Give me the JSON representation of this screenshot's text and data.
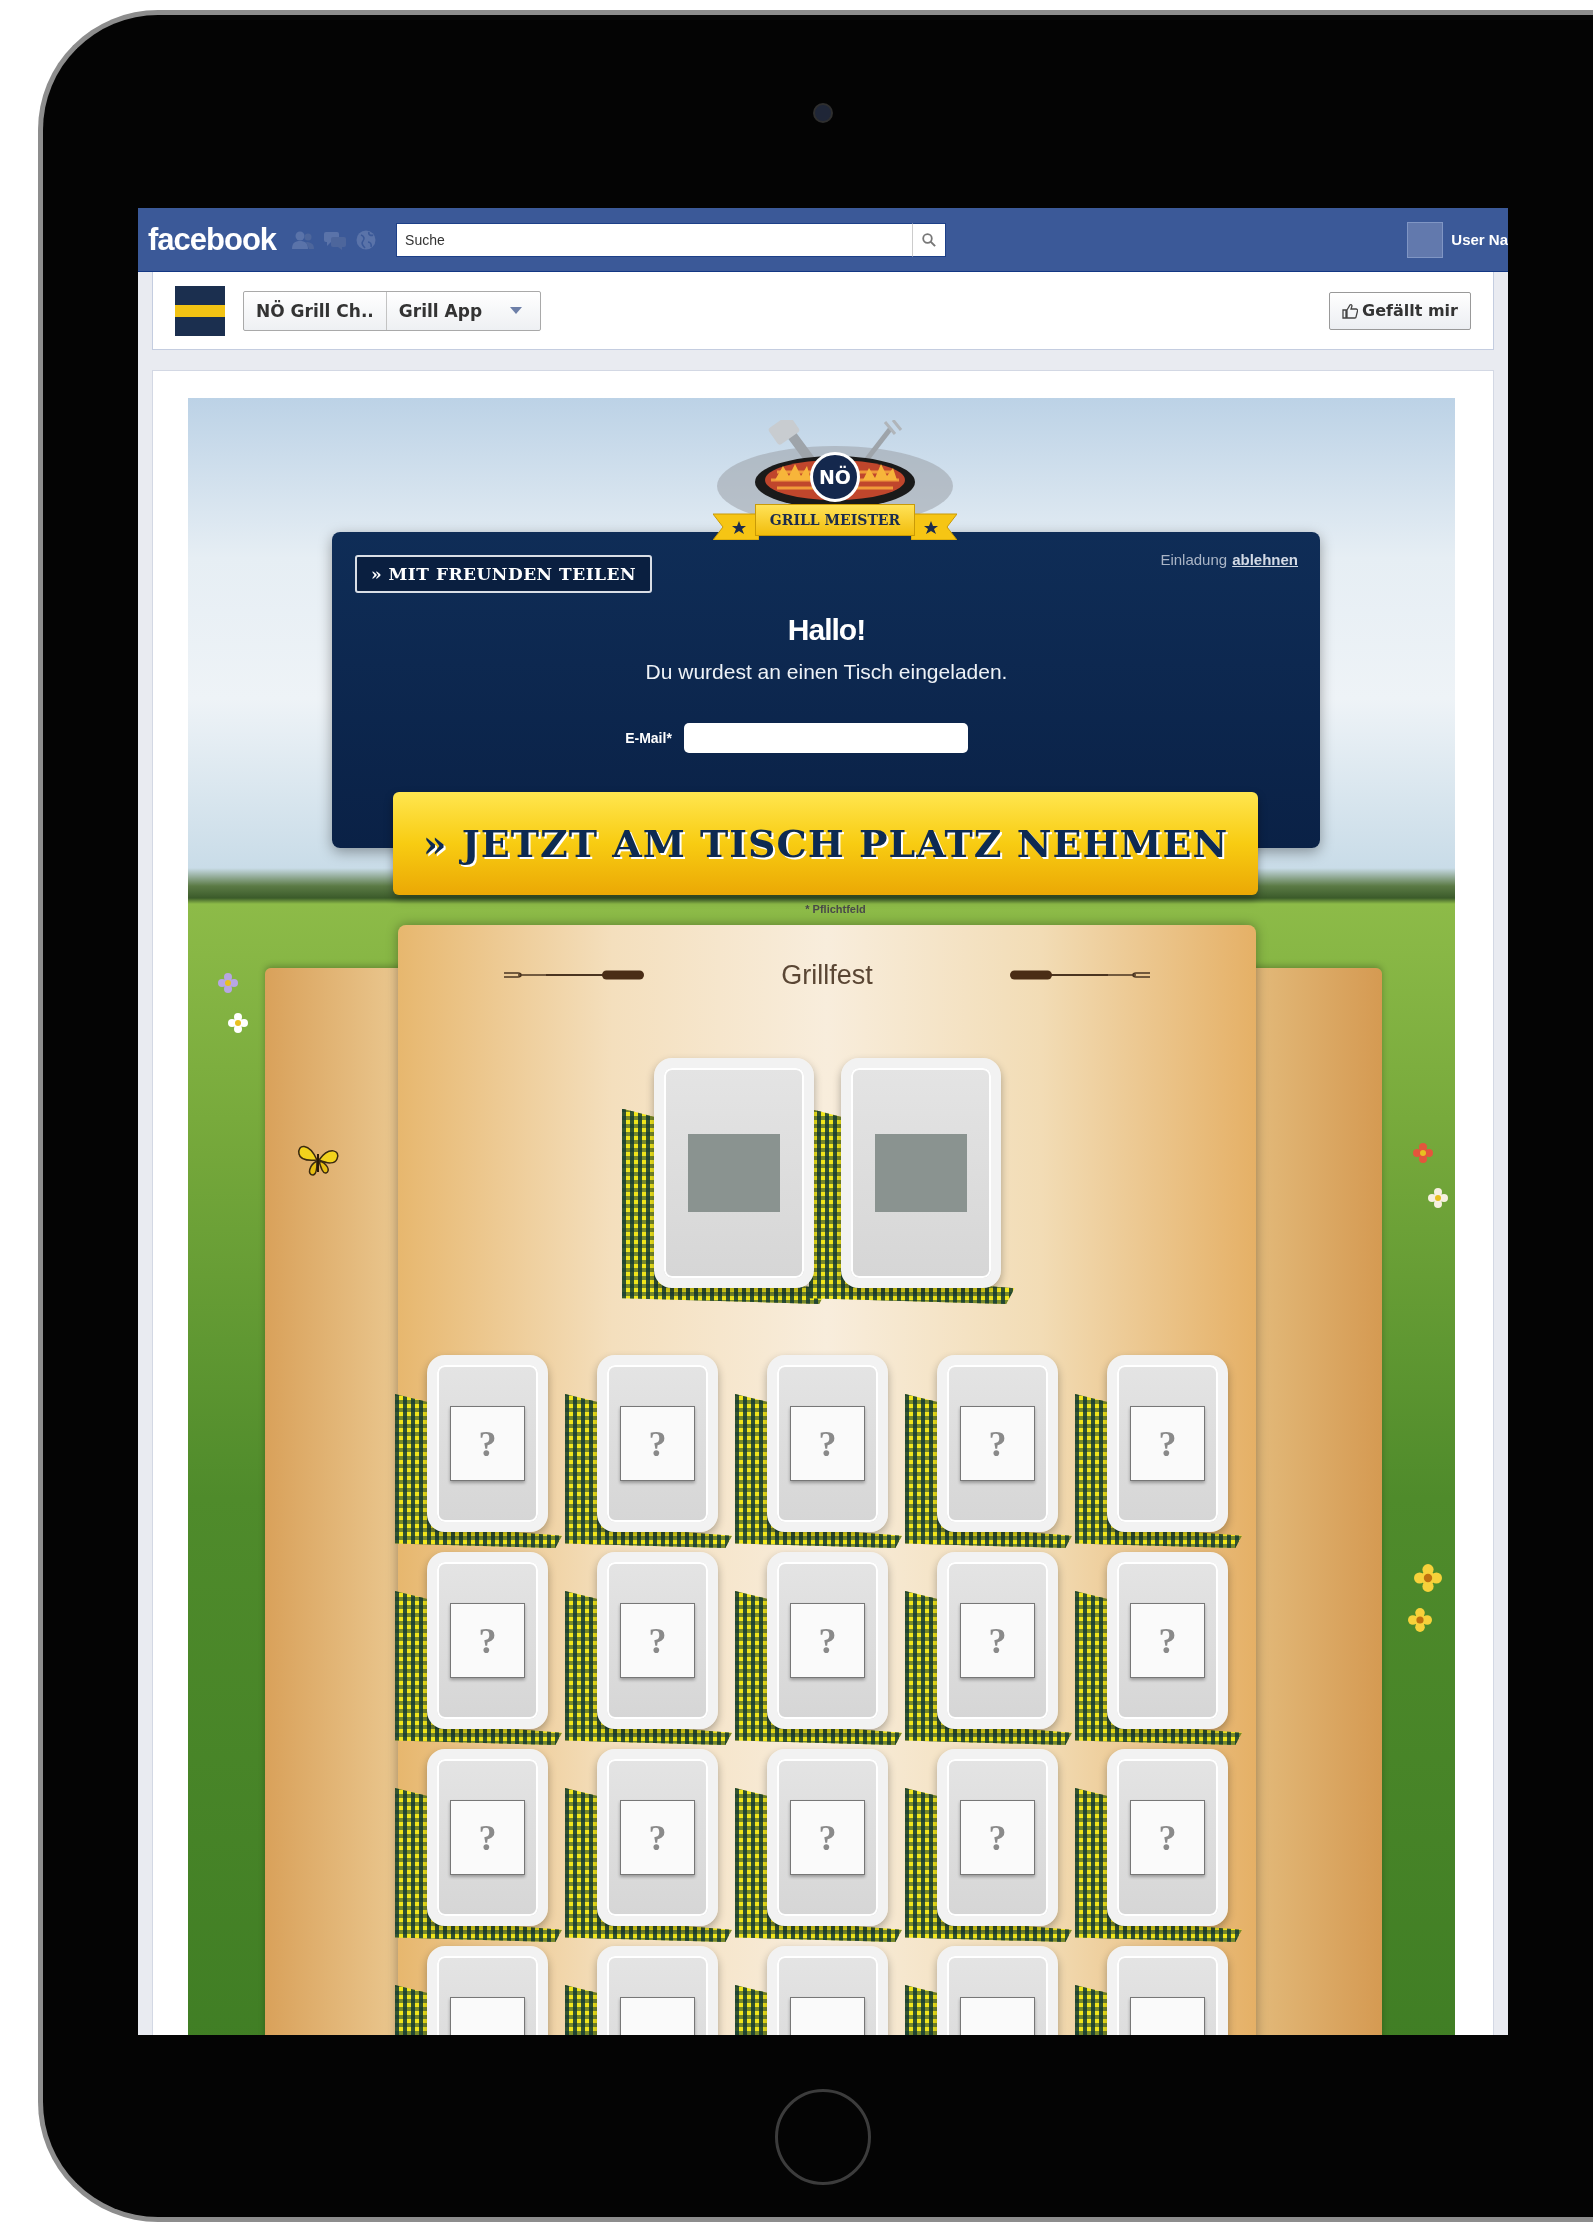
{
  "top_bar": {
    "brand": "facebook",
    "search": {
      "placeholder": "Suche"
    },
    "user_name": "User Na"
  },
  "page_header": {
    "breadcrumb": [
      "NÖ Grill Ch..",
      "Grill App"
    ],
    "like_button": "Gefällt mir"
  },
  "app": {
    "logo": {
      "badge": "NÖ",
      "banner": "GRILL MEISTER"
    },
    "share_button": "» MIT FREUNDEN TEILEN",
    "decline": {
      "prefix": "Einladung",
      "link": "ablehnen"
    },
    "greeting": "Hallo!",
    "message": "Du wurdest an einen Tisch eingeladen.",
    "email": {
      "label": "E-Mail*"
    },
    "submit_button": "» JETZT AM TISCH PLATZ NEHMEN",
    "required_note": "* Pflichtfeld",
    "table": {
      "title": "Grillfest",
      "guests": [
        {
          "kind": "photo"
        },
        {
          "kind": "photo"
        }
      ],
      "seats": [
        {
          "kind": "empty",
          "label": "?"
        },
        {
          "kind": "empty",
          "label": "?"
        },
        {
          "kind": "empty",
          "label": "?"
        },
        {
          "kind": "empty",
          "label": "?"
        },
        {
          "kind": "empty",
          "label": "?"
        },
        {
          "kind": "empty",
          "label": "?"
        },
        {
          "kind": "empty",
          "label": "?"
        },
        {
          "kind": "empty",
          "label": "?"
        },
        {
          "kind": "empty",
          "label": "?"
        },
        {
          "kind": "empty",
          "label": "?"
        },
        {
          "kind": "empty",
          "label": "?"
        },
        {
          "kind": "empty",
          "label": "?"
        },
        {
          "kind": "empty",
          "label": "?"
        },
        {
          "kind": "empty",
          "label": "?"
        },
        {
          "kind": "empty",
          "label": "?"
        },
        {
          "kind": "empty"
        },
        {
          "kind": "empty"
        },
        {
          "kind": "empty"
        },
        {
          "kind": "empty"
        },
        {
          "kind": "empty"
        }
      ]
    }
  }
}
